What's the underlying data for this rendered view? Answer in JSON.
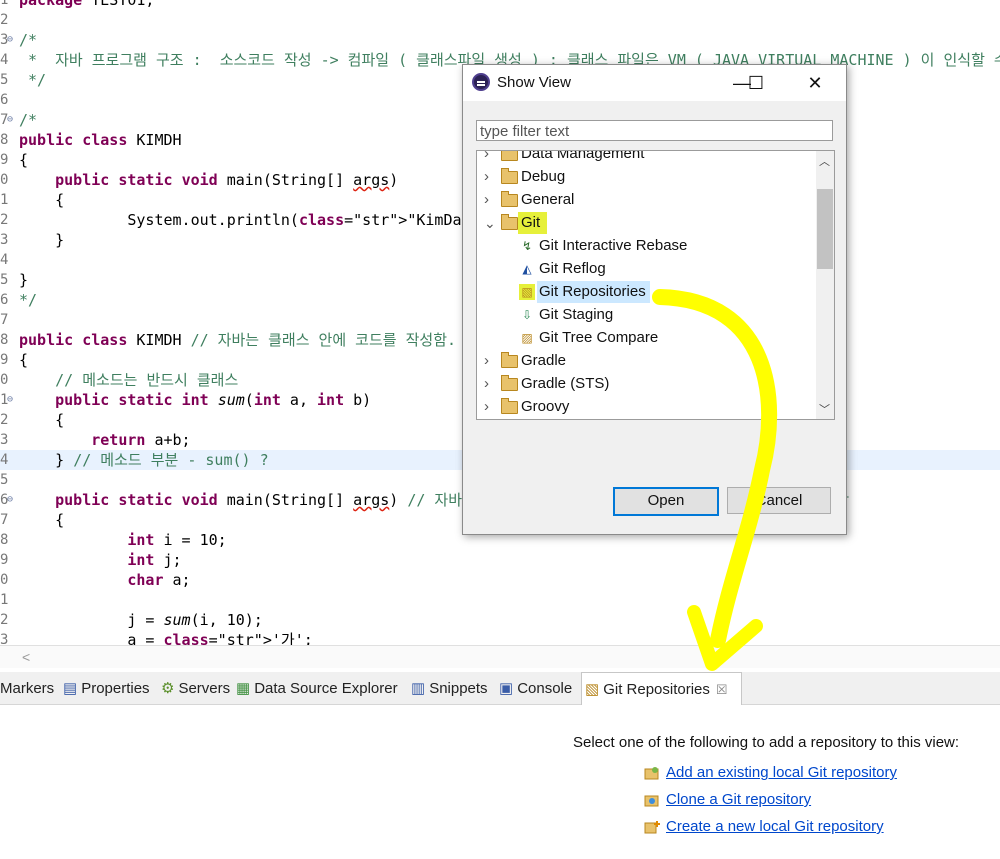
{
  "editor": {
    "lines": [
      {
        "num": "1",
        "code": "package TEST01;"
      },
      {
        "num": "2",
        "code": ""
      },
      {
        "num": "3",
        "fold": true,
        "code": "/*"
      },
      {
        "num": "4",
        "code": " *  자바 프로그램 구조 :  소스코드 작성 -> 컴파일 ( 클래스파일 생성 ) : 클래스 파일은 VM ( JAVA VIRTUAL MACHINE ) 이 인식할 수 있는 바이너리"
      },
      {
        "num": "5",
        "code": " */"
      },
      {
        "num": "6",
        "code": ""
      },
      {
        "num": "7",
        "fold": true,
        "code": "/*"
      },
      {
        "num": "8",
        "code": "public class KIMDH"
      },
      {
        "num": "9",
        "code": "{"
      },
      {
        "num": "0",
        "code": "    public static void main(String[] args)"
      },
      {
        "num": "1",
        "code": "    {"
      },
      {
        "num": "2",
        "code": "            System.out.println(\"KimDaeHan\");"
      },
      {
        "num": "3",
        "code": "    }"
      },
      {
        "num": "4",
        "code": ""
      },
      {
        "num": "5",
        "code": "}"
      },
      {
        "num": "6",
        "code": "*/"
      },
      {
        "num": "7",
        "code": ""
      },
      {
        "num": "8",
        "code": "public class KIMDH // 자바는 클래스 안에 코드를 작성함."
      },
      {
        "num": "9",
        "code": "{"
      },
      {
        "num": "0",
        "code": "    // 메소드는 반드시 클래스"
      },
      {
        "num": "1",
        "fold": true,
        "code": "    public static int sum(int a, int b)"
      },
      {
        "num": "2",
        "code": "    {"
      },
      {
        "num": "3",
        "code": "        return a+b;"
      },
      {
        "num": "4",
        "code": "    } // 메소드 부분 - sum() ?"
      },
      {
        "num": "5",
        "code": ""
      },
      {
        "num": "6",
        "fold": true,
        "code": "    public static void main(String[] args) // 자바의 메인 함수는 반드시 public static void 붙여야함"
      },
      {
        "num": "7",
        "code": "    {"
      },
      {
        "num": "8",
        "code": "            int i = 10;"
      },
      {
        "num": "9",
        "code": "            int j;"
      },
      {
        "num": "0",
        "code": "            char a;"
      },
      {
        "num": "1",
        "code": ""
      },
      {
        "num": "2",
        "code": "            j = sum(i, 10);"
      },
      {
        "num": "3",
        "code": "            a = '가';"
      }
    ]
  },
  "dialog": {
    "title": "Show View",
    "minimize": "—",
    "maximize": "☐",
    "close": "✕",
    "filter_placeholder": "type filter text",
    "tree": [
      {
        "label": "Data Management",
        "type": "folder",
        "expanded": false
      },
      {
        "label": "Debug",
        "type": "folder",
        "expanded": false
      },
      {
        "label": "General",
        "type": "folder",
        "expanded": false
      },
      {
        "label": "Git",
        "type": "folder",
        "expanded": true
      },
      {
        "label": "Git Interactive Rebase",
        "type": "child",
        "icon": "rebase-icon"
      },
      {
        "label": "Git Reflog",
        "type": "child",
        "icon": "reflog-icon"
      },
      {
        "label": "Git Repositories",
        "type": "child",
        "icon": "git-repo-icon",
        "selected": true
      },
      {
        "label": "Git Staging",
        "type": "child",
        "icon": "staging-icon"
      },
      {
        "label": "Git Tree Compare",
        "type": "child",
        "icon": "tree-compare-icon"
      },
      {
        "label": "Gradle",
        "type": "folder",
        "expanded": false
      },
      {
        "label": "Gradle (STS)",
        "type": "folder",
        "expanded": false
      },
      {
        "label": "Groovy",
        "type": "folder",
        "expanded": false
      }
    ],
    "open_label": "Open",
    "cancel_label": "Cancel"
  },
  "tabs": [
    {
      "label": "Markers",
      "icon": ""
    },
    {
      "label": "Properties",
      "icon": "properties-icon"
    },
    {
      "label": "Servers",
      "icon": "servers-icon"
    },
    {
      "label": "Data Source Explorer",
      "icon": "data-source-icon"
    },
    {
      "label": "Snippets",
      "icon": "snippets-icon"
    },
    {
      "label": "Console",
      "icon": "console-icon"
    },
    {
      "label": "Git Repositories",
      "icon": "git-repo-icon",
      "active": true
    }
  ],
  "gitview": {
    "intro": "Select one of the following to add a repository to this view:",
    "links": [
      "Add an existing local Git repository",
      "Clone a Git repository",
      "Create a new local Git repository"
    ]
  },
  "colors": {
    "highlight": "#e6f03a",
    "annotation": "#ffff00",
    "link": "#0047cc"
  }
}
